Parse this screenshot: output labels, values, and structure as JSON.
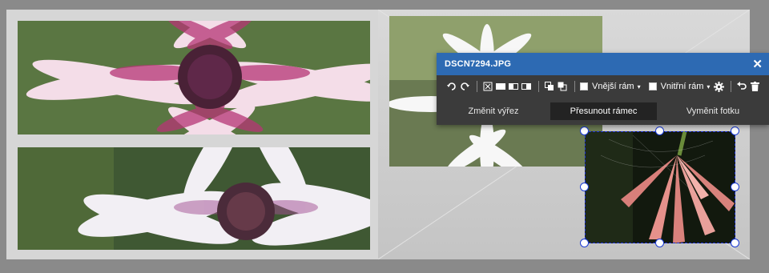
{
  "editor": {
    "title": "DSCN7294.JPG",
    "close_label": "✕",
    "toolbar": {
      "outer_frame_label": "Vnější rám",
      "inner_frame_label": "Vnitřní rám",
      "dropdown_arrow": "▾"
    },
    "tabs": [
      {
        "label": "Změnit výřez",
        "active": false
      },
      {
        "label": "Přesunout rámec",
        "active": true
      },
      {
        "label": "Vyměnit fotku",
        "active": false
      }
    ]
  },
  "photos": [
    {
      "subject": "pink daisy close-up"
    },
    {
      "subject": "white-pink daisy close-up"
    },
    {
      "subject": "white daisy"
    },
    {
      "subject": "pink lily"
    }
  ],
  "colors": {
    "editor_header": "#2d6ab3",
    "editor_body": "#3b3b3b",
    "active_tab": "#232323",
    "selection_border": "#1a2fd6"
  }
}
